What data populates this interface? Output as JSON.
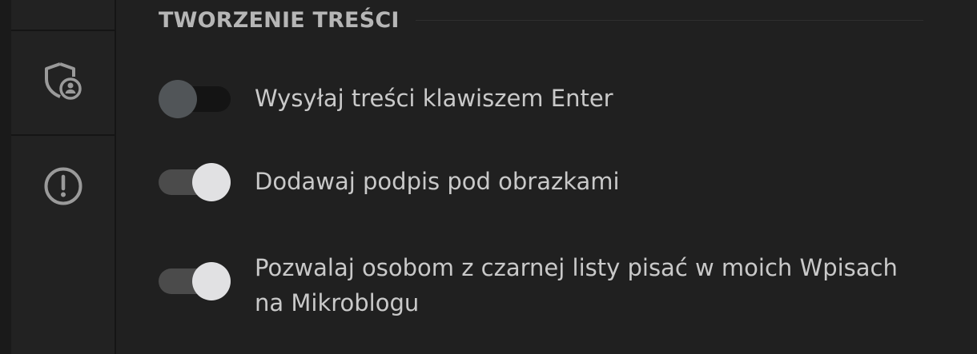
{
  "section": {
    "title": "TWORZENIE TREŚCI"
  },
  "settings": [
    {
      "label": "Wysyłaj treści klawiszem Enter",
      "enabled": false
    },
    {
      "label": "Dodawaj podpis pod obrazkami",
      "enabled": true
    },
    {
      "label_line1": "Pozwalaj osobom z czarnej listy pisać w moich Wpisach",
      "label_line2": "na Mikroblogu",
      "enabled": true
    }
  ],
  "sidebar": {
    "icons": [
      "shield-user-icon",
      "alert-circle-icon"
    ]
  },
  "colors": {
    "background": "#202020",
    "toggle_on_knob": "#e1e1e3",
    "toggle_off_knob": "#515558",
    "text": "#c9c9c9"
  }
}
